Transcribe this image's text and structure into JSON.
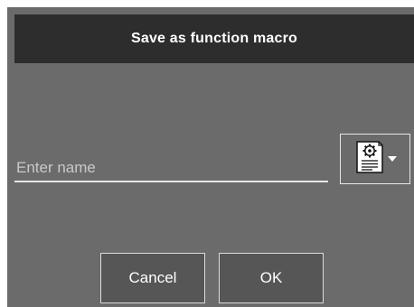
{
  "dialog": {
    "title": "Save as function macro",
    "name_field": {
      "placeholder": "Enter name",
      "value": ""
    },
    "icon_picker": {
      "icon": "document-gear-icon",
      "dropdown_icon": "caret-down-icon"
    },
    "buttons": {
      "cancel": "Cancel",
      "ok": "OK"
    }
  },
  "colors": {
    "dialog_background": "#6b6b6b",
    "title_bar": "#2d2d2d",
    "button_background": "#565656",
    "border_light": "#e6e6e6"
  }
}
